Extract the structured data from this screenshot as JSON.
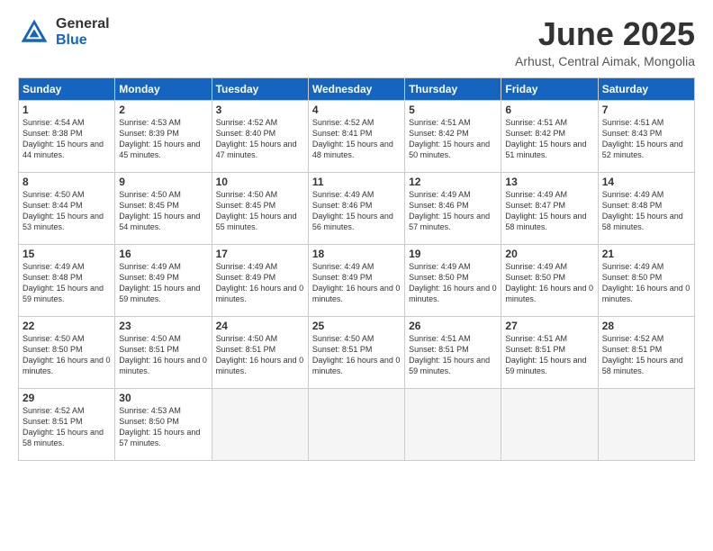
{
  "logo": {
    "general": "General",
    "blue": "Blue"
  },
  "title": "June 2025",
  "subtitle": "Arhust, Central Aimak, Mongolia",
  "headers": [
    "Sunday",
    "Monday",
    "Tuesday",
    "Wednesday",
    "Thursday",
    "Friday",
    "Saturday"
  ],
  "weeks": [
    [
      {
        "num": "1",
        "rise": "4:54 AM",
        "set": "8:38 PM",
        "daylight": "15 hours and 44 minutes."
      },
      {
        "num": "2",
        "rise": "4:53 AM",
        "set": "8:39 PM",
        "daylight": "15 hours and 45 minutes."
      },
      {
        "num": "3",
        "rise": "4:52 AM",
        "set": "8:40 PM",
        "daylight": "15 hours and 47 minutes."
      },
      {
        "num": "4",
        "rise": "4:52 AM",
        "set": "8:41 PM",
        "daylight": "15 hours and 48 minutes."
      },
      {
        "num": "5",
        "rise": "4:51 AM",
        "set": "8:42 PM",
        "daylight": "15 hours and 50 minutes."
      },
      {
        "num": "6",
        "rise": "4:51 AM",
        "set": "8:42 PM",
        "daylight": "15 hours and 51 minutes."
      },
      {
        "num": "7",
        "rise": "4:51 AM",
        "set": "8:43 PM",
        "daylight": "15 hours and 52 minutes."
      }
    ],
    [
      {
        "num": "8",
        "rise": "4:50 AM",
        "set": "8:44 PM",
        "daylight": "15 hours and 53 minutes."
      },
      {
        "num": "9",
        "rise": "4:50 AM",
        "set": "8:45 PM",
        "daylight": "15 hours and 54 minutes."
      },
      {
        "num": "10",
        "rise": "4:50 AM",
        "set": "8:45 PM",
        "daylight": "15 hours and 55 minutes."
      },
      {
        "num": "11",
        "rise": "4:49 AM",
        "set": "8:46 PM",
        "daylight": "15 hours and 56 minutes."
      },
      {
        "num": "12",
        "rise": "4:49 AM",
        "set": "8:46 PM",
        "daylight": "15 hours and 57 minutes."
      },
      {
        "num": "13",
        "rise": "4:49 AM",
        "set": "8:47 PM",
        "daylight": "15 hours and 58 minutes."
      },
      {
        "num": "14",
        "rise": "4:49 AM",
        "set": "8:48 PM",
        "daylight": "15 hours and 58 minutes."
      }
    ],
    [
      {
        "num": "15",
        "rise": "4:49 AM",
        "set": "8:48 PM",
        "daylight": "15 hours and 59 minutes."
      },
      {
        "num": "16",
        "rise": "4:49 AM",
        "set": "8:49 PM",
        "daylight": "15 hours and 59 minutes."
      },
      {
        "num": "17",
        "rise": "4:49 AM",
        "set": "8:49 PM",
        "daylight": "16 hours and 0 minutes."
      },
      {
        "num": "18",
        "rise": "4:49 AM",
        "set": "8:49 PM",
        "daylight": "16 hours and 0 minutes."
      },
      {
        "num": "19",
        "rise": "4:49 AM",
        "set": "8:50 PM",
        "daylight": "16 hours and 0 minutes."
      },
      {
        "num": "20",
        "rise": "4:49 AM",
        "set": "8:50 PM",
        "daylight": "16 hours and 0 minutes."
      },
      {
        "num": "21",
        "rise": "4:49 AM",
        "set": "8:50 PM",
        "daylight": "16 hours and 0 minutes."
      }
    ],
    [
      {
        "num": "22",
        "rise": "4:50 AM",
        "set": "8:50 PM",
        "daylight": "16 hours and 0 minutes."
      },
      {
        "num": "23",
        "rise": "4:50 AM",
        "set": "8:51 PM",
        "daylight": "16 hours and 0 minutes."
      },
      {
        "num": "24",
        "rise": "4:50 AM",
        "set": "8:51 PM",
        "daylight": "16 hours and 0 minutes."
      },
      {
        "num": "25",
        "rise": "4:50 AM",
        "set": "8:51 PM",
        "daylight": "16 hours and 0 minutes."
      },
      {
        "num": "26",
        "rise": "4:51 AM",
        "set": "8:51 PM",
        "daylight": "15 hours and 59 minutes."
      },
      {
        "num": "27",
        "rise": "4:51 AM",
        "set": "8:51 PM",
        "daylight": "15 hours and 59 minutes."
      },
      {
        "num": "28",
        "rise": "4:52 AM",
        "set": "8:51 PM",
        "daylight": "15 hours and 58 minutes."
      }
    ],
    [
      {
        "num": "29",
        "rise": "4:52 AM",
        "set": "8:51 PM",
        "daylight": "15 hours and 58 minutes."
      },
      {
        "num": "30",
        "rise": "4:53 AM",
        "set": "8:50 PM",
        "daylight": "15 hours and 57 minutes."
      },
      null,
      null,
      null,
      null,
      null
    ]
  ]
}
